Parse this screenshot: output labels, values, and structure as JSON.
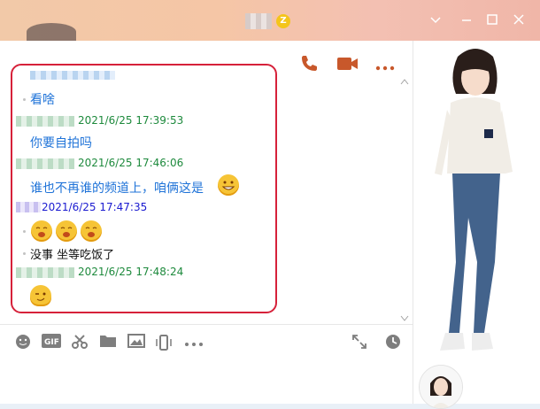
{
  "window": {
    "badge": "Z"
  },
  "messages": [
    {
      "text": "看啥"
    },
    {
      "timestamp": "2021/6/25 17:39:53"
    },
    {
      "text": "你要自拍吗"
    },
    {
      "timestamp": "2021/6/25 17:46:06"
    },
    {
      "text": "谁也不再谁的频道上，咱俩这是"
    },
    {
      "timestamp": "2021/6/25 17:47:35"
    },
    {
      "text": "没事 坐等吃饭了"
    },
    {
      "timestamp": "2021/6/25 17:48:24"
    }
  ],
  "icons": {
    "titlebar": [
      "chevron-down-icon",
      "minimize-icon",
      "maximize-icon",
      "close-icon"
    ],
    "header_actions": [
      "phone-icon",
      "video-call-icon",
      "more-icon"
    ],
    "toolbar": [
      "emoji-icon",
      "gif-icon",
      "screenshot-scissors-icon",
      "folder-icon",
      "image-icon",
      "shake-window-icon",
      "more-icon",
      "expand-icon",
      "history-clock-icon"
    ]
  },
  "colors": {
    "highlight_border": "#d6213a",
    "sender_green": "#1e8a3d",
    "sender_blue": "#1a1ad0",
    "message_blue": "#1f73d8",
    "action_orange": "#c8582b"
  }
}
